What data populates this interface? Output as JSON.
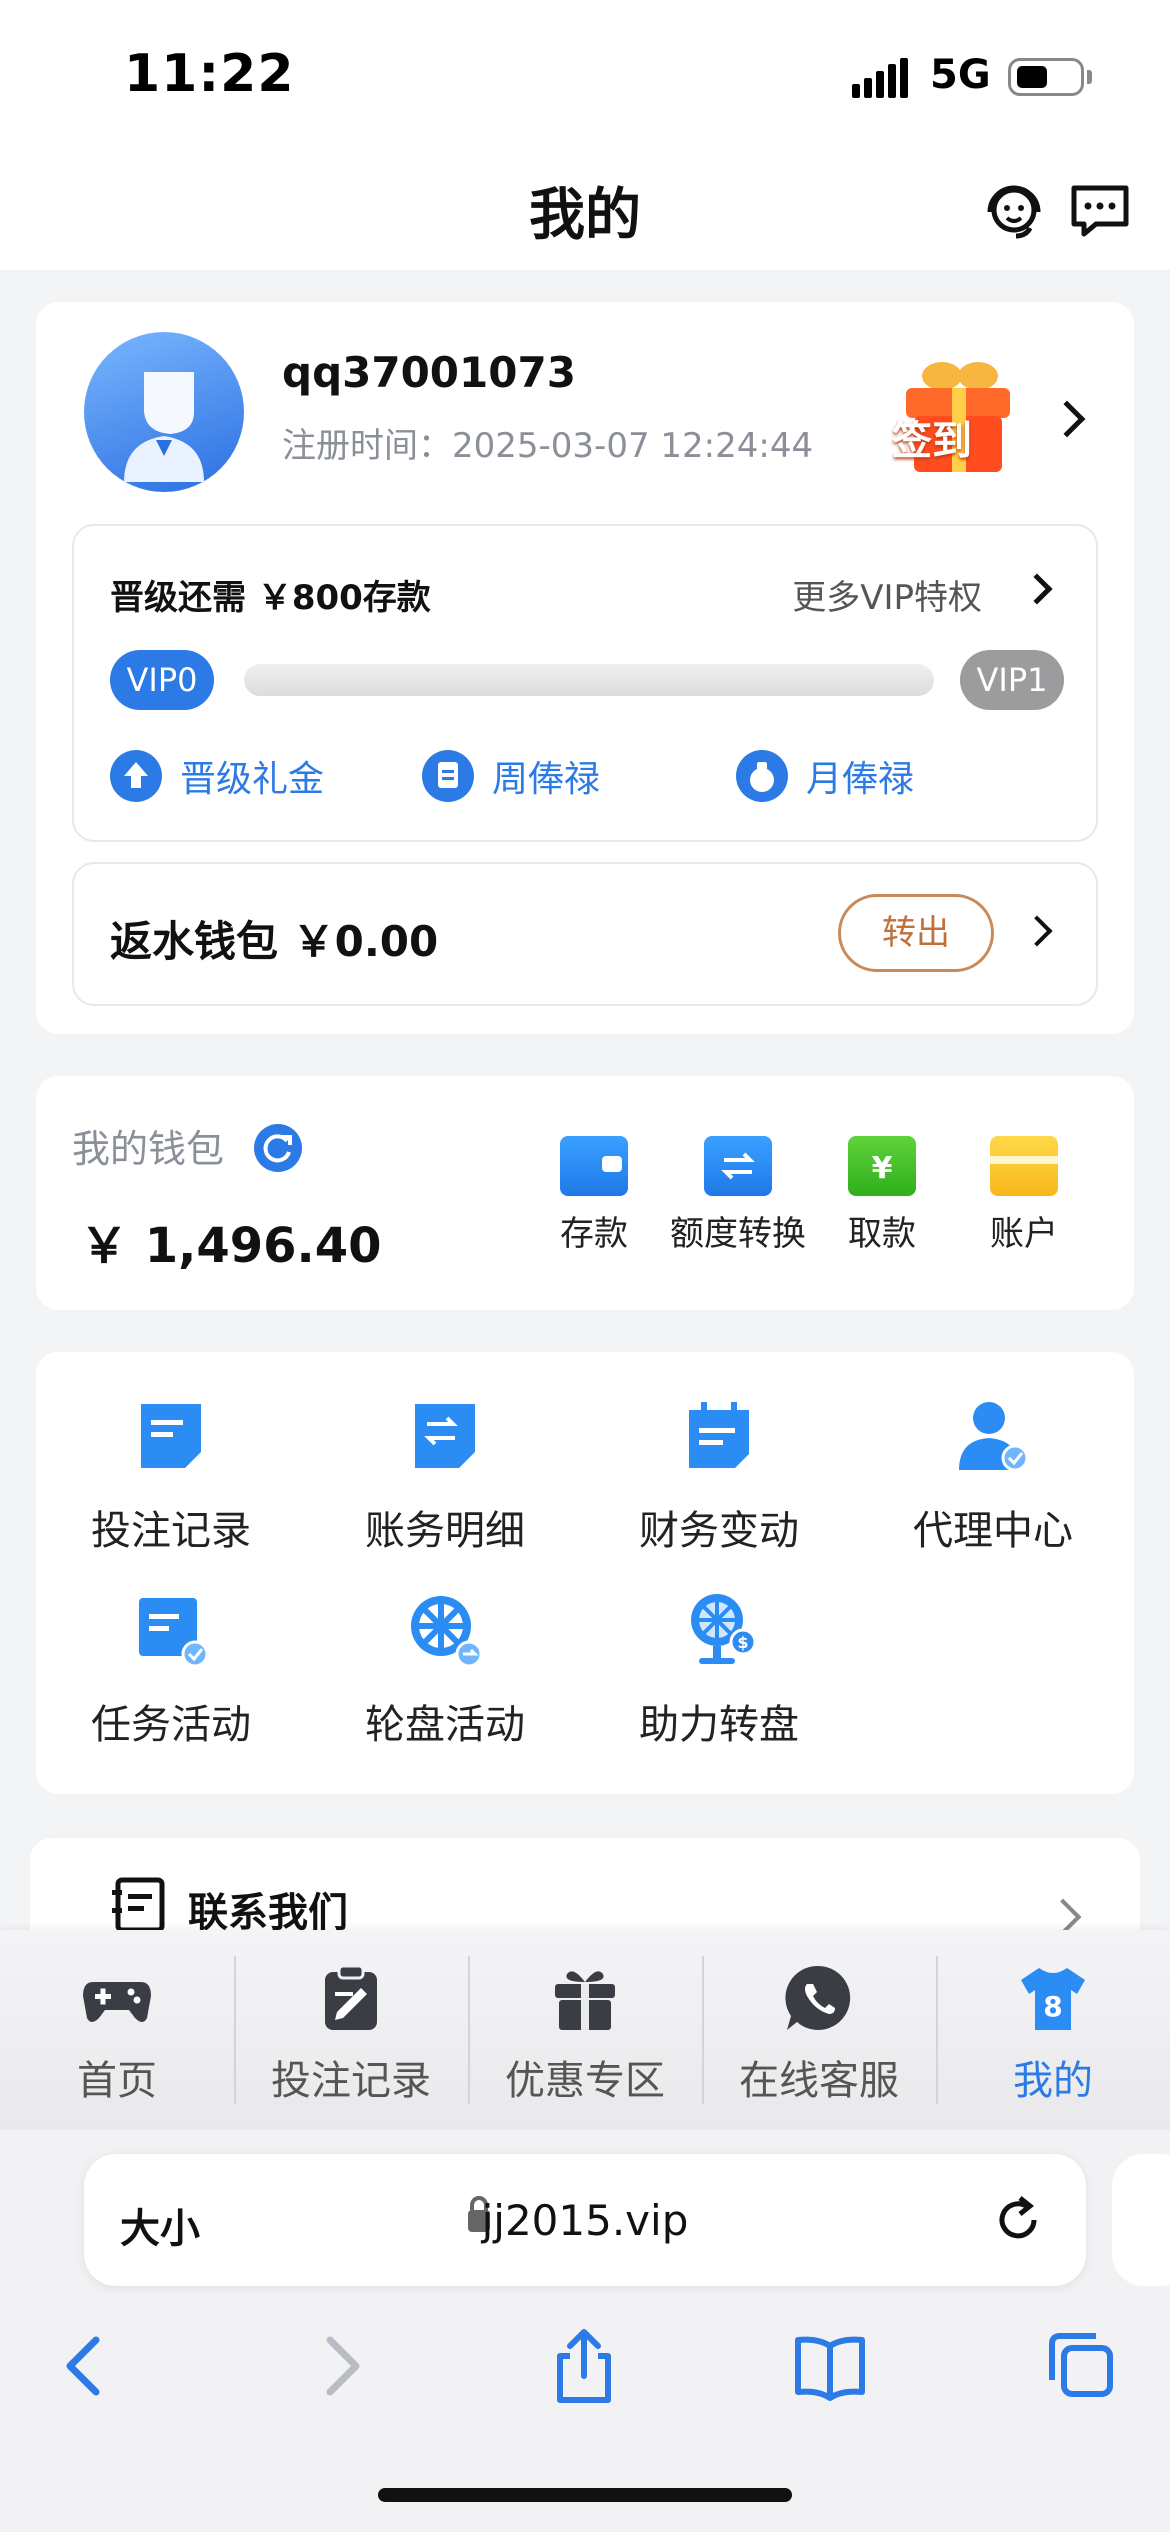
{
  "status_bar": {
    "time": "11:22",
    "network": "5G"
  },
  "header": {
    "title": "我的",
    "icons": [
      "headset-icon",
      "chat-bubble-icon"
    ]
  },
  "profile": {
    "username": "qq37001073",
    "register_label": "注册时间：",
    "register_time": "2025-03-07 12:24:44",
    "signin_label": "签到"
  },
  "vip": {
    "need_text": "晋级还需 ￥800存款",
    "more_text": "更多VIP特权",
    "current": "VIP0",
    "next": "VIP1",
    "progress": 0,
    "perks": [
      "晋级礼金",
      "周俸禄",
      "月俸禄"
    ]
  },
  "rebate": {
    "label": "返水钱包 ￥0.00",
    "button": "转出"
  },
  "wallet": {
    "title": "我的钱包",
    "amount": "￥ 1,496.40",
    "actions": [
      "存款",
      "额度转换",
      "取款",
      "账户"
    ]
  },
  "features": [
    "投注记录",
    "账务明细",
    "财务变动",
    "代理中心",
    "任务活动",
    "轮盘活动",
    "助力转盘"
  ],
  "contact": {
    "label": "联系我们"
  },
  "tabbar": {
    "tabs": [
      "首页",
      "投注记录",
      "优惠专区",
      "在线客服",
      "我的"
    ],
    "active": "我的"
  },
  "browser": {
    "text_size": "大小",
    "url": "jj2015.vip"
  },
  "colors": {
    "accent": "#2b7ae6",
    "withdraw": "#c0703a",
    "page_bg": "#f3f4f6"
  }
}
